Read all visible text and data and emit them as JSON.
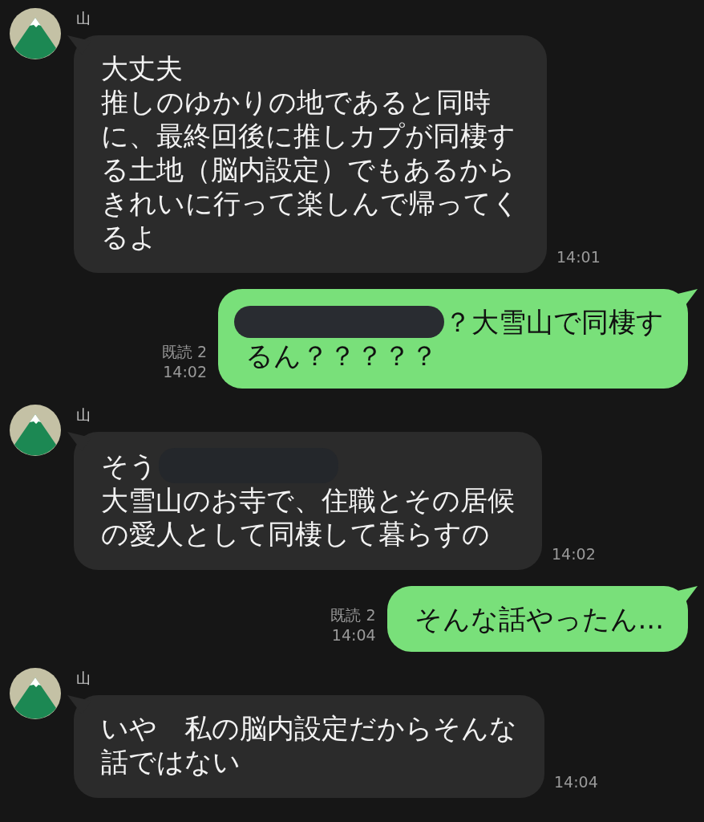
{
  "messages": [
    {
      "kind": "received",
      "sender": "山",
      "time": "14:01",
      "lines": [
        [
          {
            "kind": "text",
            "text": "大丈夫"
          }
        ],
        [
          {
            "kind": "text",
            "text": "推しのゆかりの地であると同時"
          }
        ],
        [
          {
            "kind": "text",
            "text": "に、最終回後に推しカプが同棲す"
          }
        ],
        [
          {
            "kind": "text",
            "text": "る土地（脳内設定）でもあるから"
          }
        ],
        [
          {
            "kind": "text",
            "text": "きれいに行って楽しんで帰ってく"
          }
        ],
        [
          {
            "kind": "text",
            "text": "るよ"
          }
        ]
      ]
    },
    {
      "kind": "sent",
      "read": "既読 2",
      "time": "14:02",
      "lines": [
        [
          {
            "kind": "redaction"
          },
          {
            "kind": "text",
            "text": "？大雪山で同棲す"
          }
        ],
        [
          {
            "kind": "text",
            "text": "るん？？？？？"
          }
        ]
      ]
    },
    {
      "kind": "received",
      "sender": "山",
      "time": "14:02",
      "lines": [
        [
          {
            "kind": "text",
            "text": "そう"
          },
          {
            "kind": "redaction"
          }
        ],
        [
          {
            "kind": "text",
            "text": "大雪山のお寺で、住職とその居候"
          }
        ],
        [
          {
            "kind": "text",
            "text": "の愛人として同棲して暮らすの"
          }
        ]
      ]
    },
    {
      "kind": "sent",
      "read": "既読 2",
      "time": "14:04",
      "lines": [
        [
          {
            "kind": "text",
            "text": "そんな話やったん..."
          }
        ]
      ]
    },
    {
      "kind": "received",
      "sender": "山",
      "time": "14:04",
      "lines": [
        [
          {
            "kind": "text",
            "text": "いや　私の脳内設定だからそんな"
          }
        ],
        [
          {
            "kind": "text",
            "text": "話ではない"
          }
        ]
      ]
    }
  ]
}
